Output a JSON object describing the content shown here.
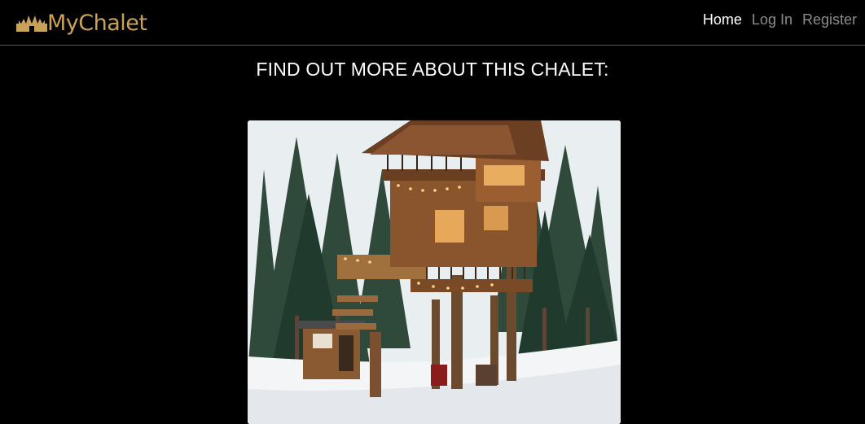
{
  "navbar": {
    "brand": "MyChalet",
    "brand_icon": "castle-crown-icon",
    "links": [
      {
        "label": "Home",
        "active": true
      },
      {
        "label": "Log In",
        "active": false
      },
      {
        "label": "Register",
        "active": false
      }
    ]
  },
  "main": {
    "heading": "FIND OUT MORE ABOUT THIS CHALET:",
    "image": {
      "alt": "Treehouse chalet in snowy pine forest",
      "subject": "treehouse-chalet-photo"
    }
  },
  "colors": {
    "background": "#000000",
    "brand_gold": "#c9a25a",
    "nav_active": "#ffffff",
    "nav_inactive": "#8c8c8c",
    "divider": "#5a5a5a"
  }
}
